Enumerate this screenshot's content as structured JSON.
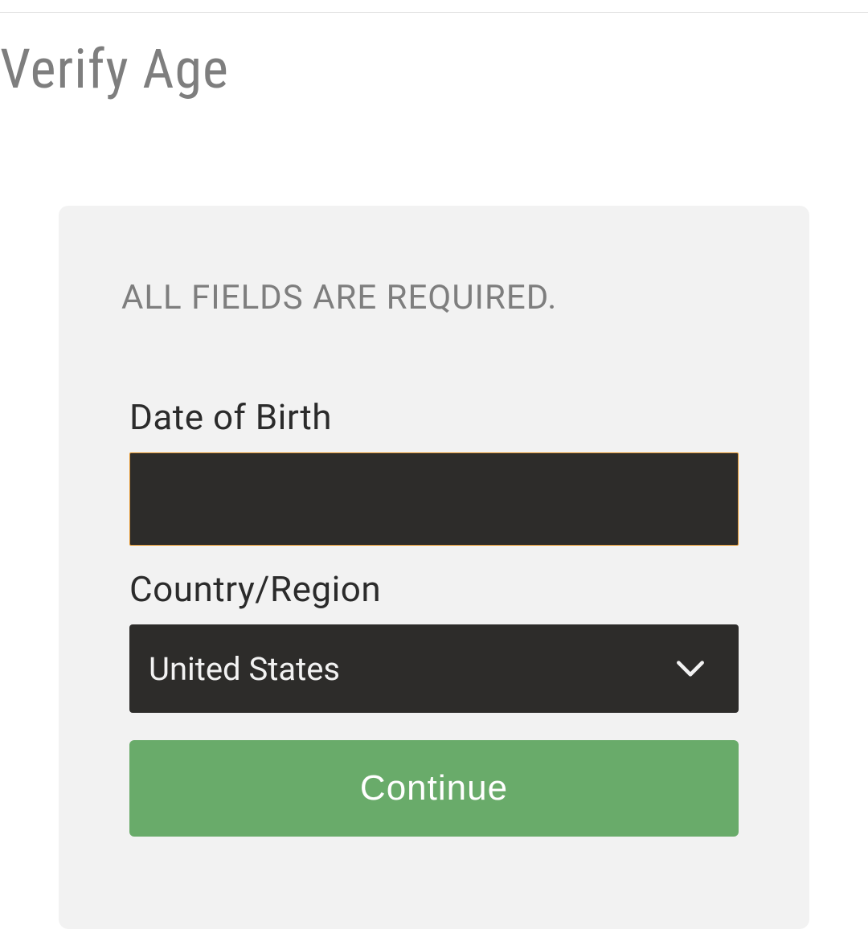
{
  "page": {
    "title": "Verify Age"
  },
  "form": {
    "required_note": "ALL FIELDS ARE REQUIRED.",
    "dob": {
      "label": "Date of Birth",
      "value": ""
    },
    "country": {
      "label": "Country/Region",
      "selected": "United States"
    },
    "continue_label": "Continue"
  },
  "colors": {
    "accent_border": "#e0932a",
    "input_bg": "#2d2c2a",
    "button_bg": "#69ab6a",
    "card_bg": "#f2f2f2",
    "muted_text": "#7e7e7e"
  }
}
